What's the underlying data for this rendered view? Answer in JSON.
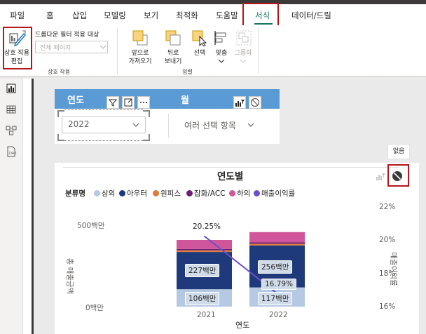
{
  "tabs": [
    {
      "label": "파일"
    },
    {
      "label": "홈"
    },
    {
      "label": "삽입"
    },
    {
      "label": "모델링"
    },
    {
      "label": "보기"
    },
    {
      "label": "최적화"
    },
    {
      "label": "도움말"
    },
    {
      "label": "서식"
    },
    {
      "label": "데이터/드릴"
    }
  ],
  "ribbon": {
    "edit_interactions": {
      "line1": "상호 작용",
      "line2": "편집"
    },
    "dropdown_filter_label": "드롭다운 필터 적용 대상",
    "dropdown_filter_value": "전체 페이지",
    "interactions_group": "상호 작용",
    "bring_forward": {
      "line1": "앞으로",
      "line2": "가져오기"
    },
    "send_backward": {
      "line1": "뒤로",
      "line2": "보내기"
    },
    "select": "선택",
    "align": "맞춤",
    "group": "그룹화",
    "arrange_group": "정렬"
  },
  "slicers": {
    "year_title": "연도",
    "year_value": "2022",
    "month_title": "월",
    "month_value": "여러 선택 항목"
  },
  "tooltip_none": "없음",
  "chart": {
    "title": "연도별",
    "legend_title": "분류명",
    "ylabel_left": "총 매출금액",
    "ylabel_right": "매출이익률",
    "xlabel": "연도",
    "y_ticks_left": [
      "500백만",
      "0백만"
    ],
    "y_ticks_right": [
      "22%",
      "20%",
      "18%",
      "16%"
    ]
  },
  "chart_data": {
    "type": "bar",
    "categories": [
      "2021",
      "2022"
    ],
    "series": [
      {
        "name": "상의",
        "values": [
          106,
          117
        ],
        "color": "#b5c9e3",
        "labels": [
          "106백만",
          "117백만"
        ]
      },
      {
        "name": "아우터",
        "values": [
          227,
          256
        ],
        "color": "#1f3a7a",
        "labels": [
          "227백만",
          "256백만"
        ]
      },
      {
        "name": "원피스",
        "values": [
          10,
          10
        ],
        "color": "#e07b39"
      },
      {
        "name": "잡화/ACC",
        "values": [
          8,
          8
        ],
        "color": "#6b1f75"
      },
      {
        "name": "하의",
        "values": [
          55,
          63
        ],
        "color": "#d0569b"
      }
    ],
    "line_series": {
      "name": "매출이익률",
      "values": [
        20.25,
        16.79
      ],
      "labels": [
        "20.25%",
        "16.79%"
      ],
      "color": "#6c4fc9"
    },
    "ylim_left": [
      0,
      500
    ],
    "ylim_right": [
      16,
      22
    ],
    "legend_placement": "top-left"
  },
  "colors": {
    "accent": "#117865",
    "slicer_header": "#5b9bd5",
    "highlight_box": "#b5161b"
  }
}
